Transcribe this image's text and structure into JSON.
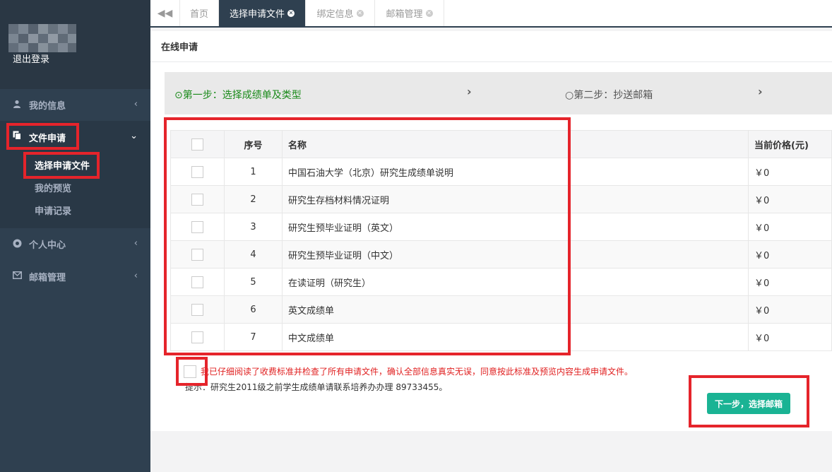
{
  "sidebar": {
    "logout": "退出登录",
    "nav": {
      "my_info": "我的信息",
      "file_apply": "文件申请",
      "personal_center": "个人中心",
      "mail_manage": "邮箱管理"
    },
    "sub": {
      "select_file": "选择申请文件",
      "my_preview": "我的预览",
      "apply_record": "申请记录"
    }
  },
  "tabs": {
    "home": "首页",
    "select_file": "选择申请文件",
    "bind_info": "绑定信息",
    "mail_manage": "邮箱管理"
  },
  "panel": {
    "title": "在线申请",
    "step1": "第一步：选择成绩单及类型",
    "step2": "第二步：抄送邮箱"
  },
  "table": {
    "headers": {
      "no": "序号",
      "name": "名称",
      "price": "当前价格(元)"
    },
    "rows": [
      {
        "no": "1",
        "name": "中国石油大学（北京）研究生成绩单说明",
        "price": "￥0"
      },
      {
        "no": "2",
        "name": "研究生存档材料情况证明",
        "price": "￥0"
      },
      {
        "no": "3",
        "name": "研究生预毕业证明（英文）",
        "price": "￥0"
      },
      {
        "no": "4",
        "name": "研究生预毕业证明（中文）",
        "price": "￥0"
      },
      {
        "no": "5",
        "name": "在读证明（研究生）",
        "price": "￥0"
      },
      {
        "no": "6",
        "name": "英文成绩单",
        "price": "￥0"
      },
      {
        "no": "7",
        "name": "中文成绩单",
        "price": "￥0"
      }
    ]
  },
  "agreement": "我已仔细阅读了收费标准并检查了所有申请文件，确认全部信息真实无误，同意按此标准及预览内容生成申请文件。",
  "tip": "提示：研究生2011级之前学生成绩单请联系培养办办理 89733455。",
  "next_button": "下一步，选择邮箱",
  "colors": {
    "sidebar": "#2f4050",
    "accent": "#1ab394",
    "highlight": "#e5242b",
    "step_active": "#1a8a1a"
  }
}
